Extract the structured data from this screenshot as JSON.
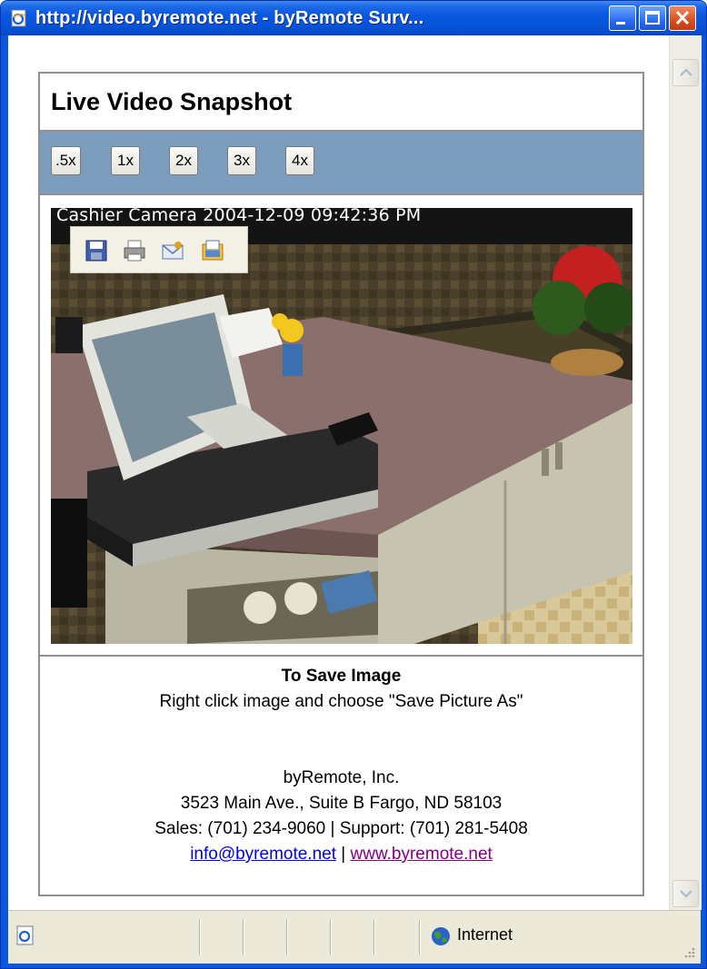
{
  "window": {
    "title": "http://video.byremote.net - byRemote Surv...",
    "min_icon": "minimize-icon",
    "max_icon": "maximize-icon",
    "close_icon": "close-icon"
  },
  "page": {
    "heading": "Live Video Snapshot",
    "zoom_buttons": [
      ".5x",
      "1x",
      "2x",
      "3x",
      "4x"
    ],
    "overlay_caption": "Cashier Camera 2004-12-09 09:42:36 PM",
    "image_toolbar_icons": [
      "save-icon",
      "print-icon",
      "mail-icon",
      "my-pictures-icon"
    ],
    "save_title": "To Save Image",
    "save_instructions": "Right click image and choose \"Save Picture As\"",
    "company": "byRemote, Inc.",
    "address": "3523 Main Ave., Suite B Fargo, ND 58103",
    "phones": "Sales: (701) 234-9060 | Support: (701) 281-5408",
    "email_link": "info@byremote.net",
    "separator": "|",
    "web_link": "www.byremote.net"
  },
  "statusbar": {
    "zone": "Internet"
  },
  "colors": {
    "titlebar": "#0a58e0",
    "zoombar": "#7d9dbe",
    "link": "#0000ee",
    "visited_link": "#800080"
  }
}
